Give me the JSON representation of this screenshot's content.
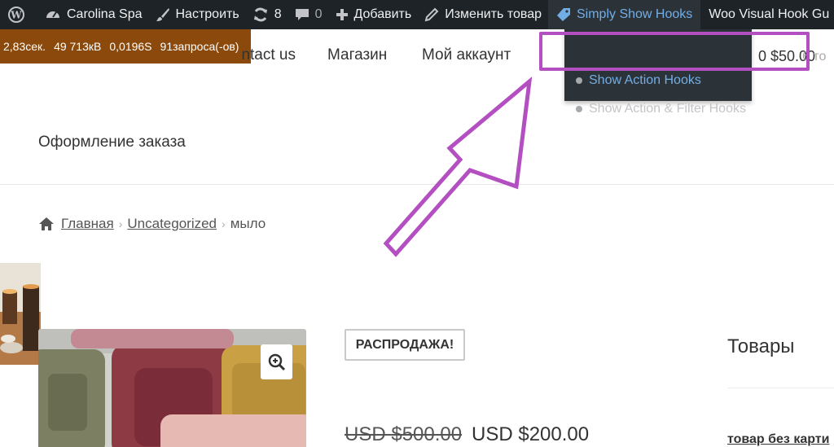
{
  "admin_bar": {
    "site_name": "Carolina Spa",
    "customize": "Настроить",
    "updates_count": "8",
    "comments_count": "0",
    "new_label": "Добавить",
    "edit_label": "Изменить товар",
    "hooks_label": "Simply Show Hooks",
    "woo_label": "Woo Visual Hook Gu"
  },
  "query_monitor": {
    "time": "2,83сек.",
    "memory": "49 713кВ",
    "db_time": "0,0196S",
    "queries": "91запроса(-ов)"
  },
  "hooks_menu": {
    "items": [
      {
        "label": "Show Action Hooks"
      },
      {
        "label": "Show Action & Filter Hooks"
      }
    ]
  },
  "nav": {
    "contact": "ntact us",
    "shop": "Магазин",
    "account": "Мой аккаунт"
  },
  "cart": {
    "amount": "0 $50.00",
    "count": "6 то"
  },
  "page": {
    "checkout": "Оформление заказа"
  },
  "breadcrumb": {
    "home": "Главная",
    "category": "Uncategorized",
    "current": "мыло"
  },
  "product": {
    "sale_badge": "РАСПРОДАЖА!",
    "price_old": "USD $500.00",
    "price_new": "USD $200.00"
  },
  "widget": {
    "title": "Товары",
    "link": "товар без карти"
  },
  "colors": {
    "adminbar_bg": "#1d2327",
    "hooks_accent": "#72aee6",
    "query_monitor_bg": "#8b4a0b",
    "annotation": "#b44fc2"
  }
}
